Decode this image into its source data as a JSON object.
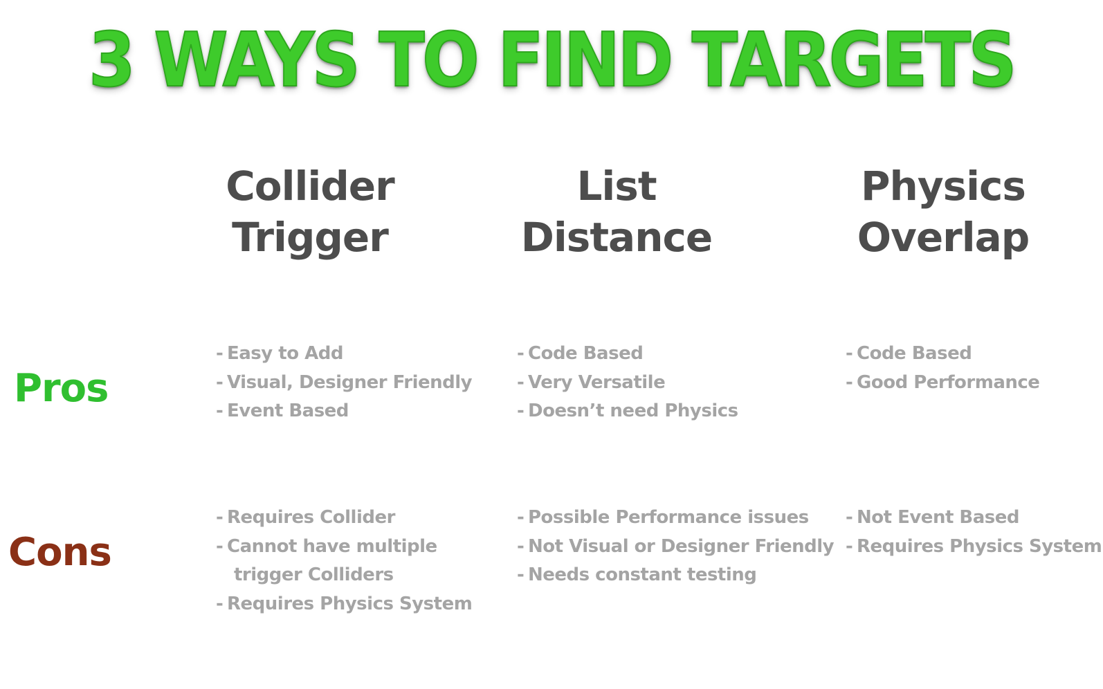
{
  "title": "3 WAYS TO FIND TARGETS",
  "columns": [
    {
      "heading_line1": "Collider",
      "heading_line2": "Trigger",
      "pros": [
        "Easy to Add",
        "Visual, Designer Friendly",
        "Event Based"
      ],
      "cons": [
        "Requires Collider",
        "Cannot have multiple",
        "trigger Colliders",
        "Requires Physics System"
      ]
    },
    {
      "heading_line1": "List",
      "heading_line2": "Distance",
      "pros": [
        "Code Based",
        "Very Versatile",
        "Doesn’t need Physics"
      ],
      "cons": [
        "Possible Performance issues",
        "Not Visual or Designer Friendly",
        "Needs constant testing"
      ]
    },
    {
      "heading_line1": "Physics",
      "heading_line2": "Overlap",
      "pros": [
        "Code Based",
        "Good Performance"
      ],
      "cons": [
        "Not Event Based",
        "Requires Physics System"
      ]
    }
  ],
  "rows": {
    "pros_label": "Pros",
    "cons_label": "Cons"
  },
  "dash": "-",
  "colors": {
    "title_green": "#3ecb2b",
    "heading_gray": "#4d4d4d",
    "pros_green": "#2fbf2f",
    "cons_brown": "#8a3016",
    "item_gray": "#a4a4a4"
  }
}
